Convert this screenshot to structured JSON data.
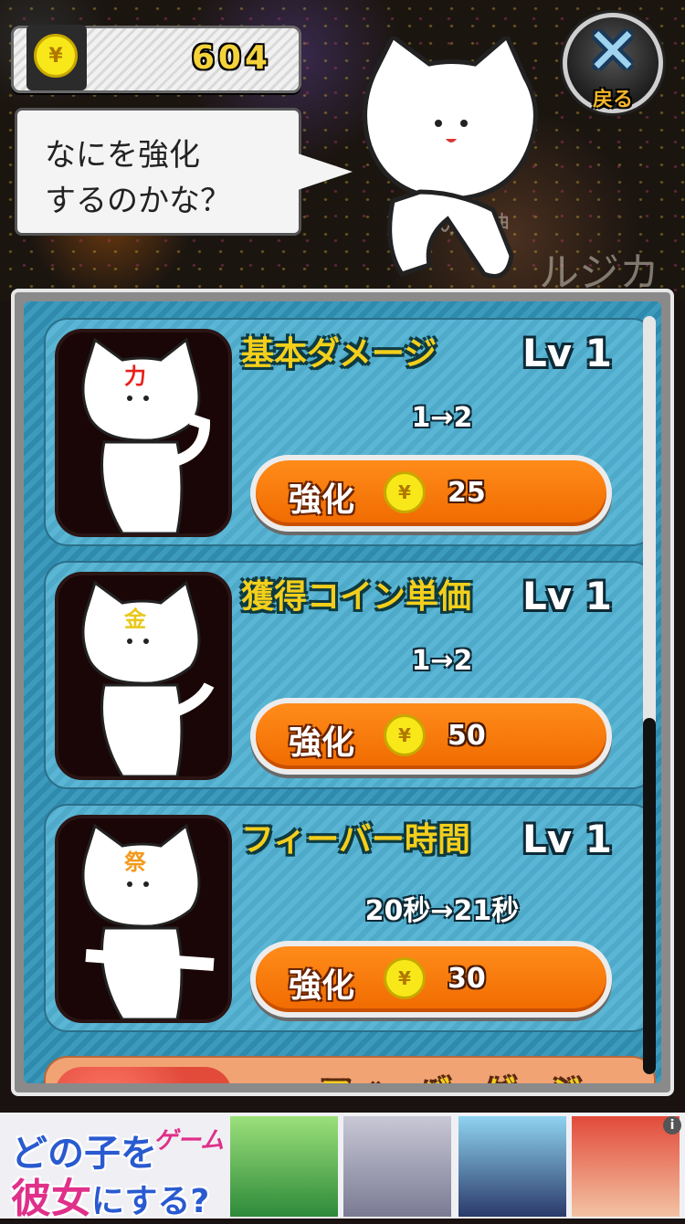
{
  "coins": {
    "count": "604",
    "icon": "yen-coin-icon",
    "symbol": "¥"
  },
  "back": {
    "label": "戻る",
    "icon": "close-x-icon"
  },
  "speech": {
    "text": "なにを強化\nするのかな？"
  },
  "background": {
    "text1": "の魔神",
    "text2": "ルジカ"
  },
  "upgrades": [
    {
      "title": "基本ダメージ",
      "level": "Lv 1",
      "change": "1→2",
      "button_label": "強化",
      "cost": "25",
      "badge": "力",
      "badge_color": "#e8201a"
    },
    {
      "title": "獲得コイン単価",
      "level": "Lv 1",
      "change": "1→2",
      "button_label": "強化",
      "cost": "50",
      "badge": "金",
      "badge_color": "#e8c81a"
    },
    {
      "title": "フィーバー時間",
      "level": "Lv 1",
      "change": "20秒→21秒",
      "button_label": "強化",
      "cost": "30",
      "badge": "祭",
      "badge_color": "#f39a1a"
    }
  ],
  "partial_upgrade": {
    "title": "フィーバーゲージ"
  },
  "ad": {
    "line1": "どの子を",
    "line2_a": "彼女",
    "line2_b": "にする?",
    "logo": "ゲーム",
    "info": "i"
  },
  "colors": {
    "accent": "#f06a00",
    "panel": "#3c9bbd",
    "title": "#f3cf1b"
  }
}
